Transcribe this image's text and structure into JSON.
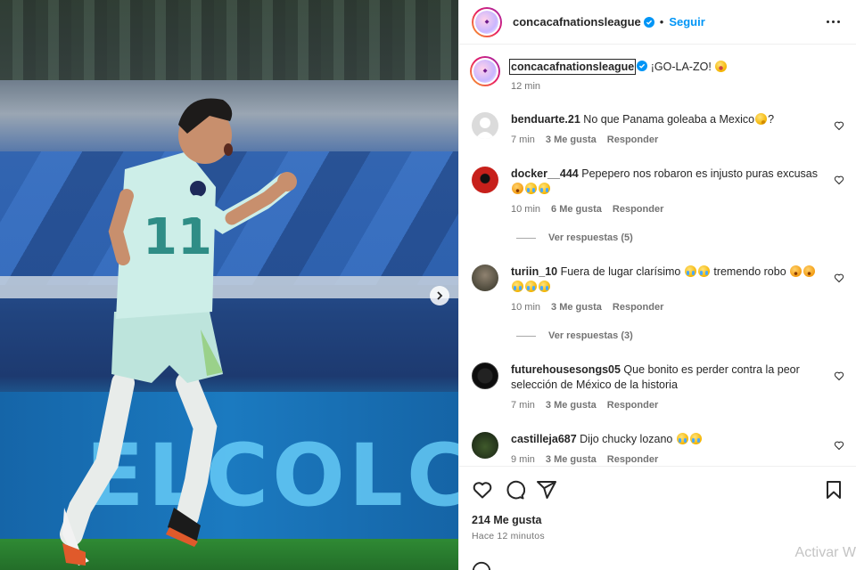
{
  "post": {
    "username": "concacafnationsleague",
    "follow_label": "Seguir",
    "caption_text": "¡GO-LA-ZO!",
    "caption_time": "12 min",
    "likes_label": "214 Me gusta",
    "posted_ago": "Hace 12 minutos",
    "jersey_number": "11"
  },
  "photo": {
    "ad_text": "ELCOLC"
  },
  "comments": [
    {
      "user": "benduarte.21",
      "text": "No que Panama goleaba a Mexico",
      "emojis": [
        "thinking-face"
      ],
      "suffix": "?",
      "time": "7 min",
      "likes": "3 Me gusta",
      "reply": "Responder"
    },
    {
      "user": "docker__444",
      "text": "Pepepero nos robaron es injusto puras excusas",
      "emojis": [
        "crying-face",
        "crying-face",
        "crying-face"
      ],
      "time": "10 min",
      "likes": "6 Me gusta",
      "reply": "Responder",
      "view_replies": "Ver respuestas (5)"
    },
    {
      "user": "turiin_10",
      "text": "Fuera de lugar clarísimo",
      "text2": "tremendo robo",
      "emojis": [
        "crying-face",
        "crying-face"
      ],
      "emojis2": [
        "frowning-face",
        "angry-face"
      ],
      "emojis3": [
        "crying-face",
        "crying-face",
        "crying-face"
      ],
      "time": "10 min",
      "likes": "3 Me gusta",
      "reply": "Responder",
      "view_replies": "Ver respuestas (3)"
    },
    {
      "user": "futurehousesongs05",
      "text": "Que bonito es perder contra la peor selección de México de la historia",
      "time": "7 min",
      "likes": "3 Me gusta",
      "reply": "Responder"
    },
    {
      "user": "castilleja687",
      "text": "Dijo chucky lozano",
      "emojis": [
        "crying-face",
        "crying-face"
      ],
      "time": "9 min",
      "likes": "3 Me gusta",
      "reply": "Responder"
    }
  ],
  "watermark": "Activar W",
  "colors": {
    "accent": "#0095f6",
    "text": "#262626",
    "muted": "#737373"
  }
}
